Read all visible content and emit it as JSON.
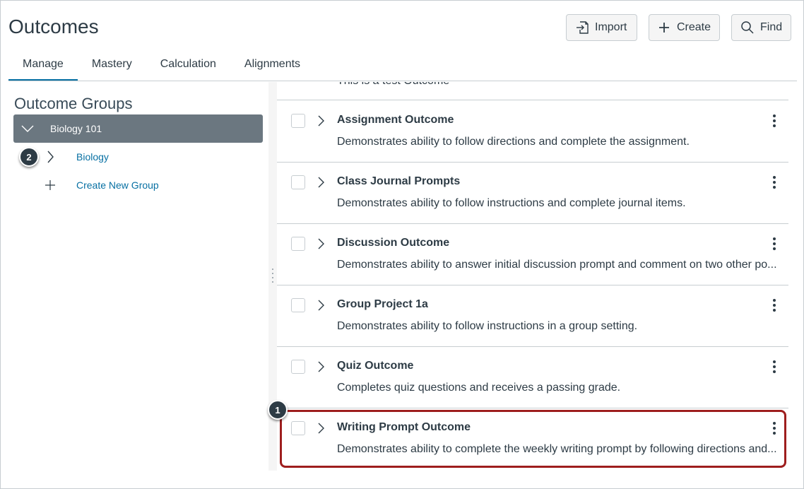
{
  "header": {
    "title": "Outcomes",
    "buttons": {
      "import": "Import",
      "create": "Create",
      "find": "Find"
    }
  },
  "tabs": [
    {
      "label": "Manage",
      "active": true
    },
    {
      "label": "Mastery",
      "active": false
    },
    {
      "label": "Calculation",
      "active": false
    },
    {
      "label": "Alignments",
      "active": false
    }
  ],
  "sidebar": {
    "heading": "Outcome Groups",
    "selected_group": "Biology 101",
    "subgroup": "Biology",
    "create_group": "Create New Group"
  },
  "list": {
    "partial_text": "This is a test Outcome",
    "outcomes": [
      {
        "title": "Assignment Outcome",
        "description": "Demonstrates ability to follow directions and complete the assignment."
      },
      {
        "title": "Class Journal Prompts",
        "description": "Demonstrates ability to follow instructions and complete journal items."
      },
      {
        "title": "Discussion Outcome",
        "description": "Demonstrates ability to answer initial discussion prompt and comment on two other po..."
      },
      {
        "title": "Group Project 1a",
        "description": "Demonstrates ability to follow instructions in a group setting."
      },
      {
        "title": "Quiz Outcome",
        "description": "Completes quiz questions and receives a passing grade."
      },
      {
        "title": "Writing Prompt Outcome",
        "description": "Demonstrates ability to complete the weekly writing prompt by following directions and..."
      }
    ]
  },
  "annotations": {
    "badge_1": "1",
    "badge_2": "2"
  },
  "colors": {
    "accent": "#0770a3",
    "selected_group_bg": "#6b7780",
    "highlight_border": "#9e1e1e",
    "badge_bg": "#2d3b45"
  }
}
